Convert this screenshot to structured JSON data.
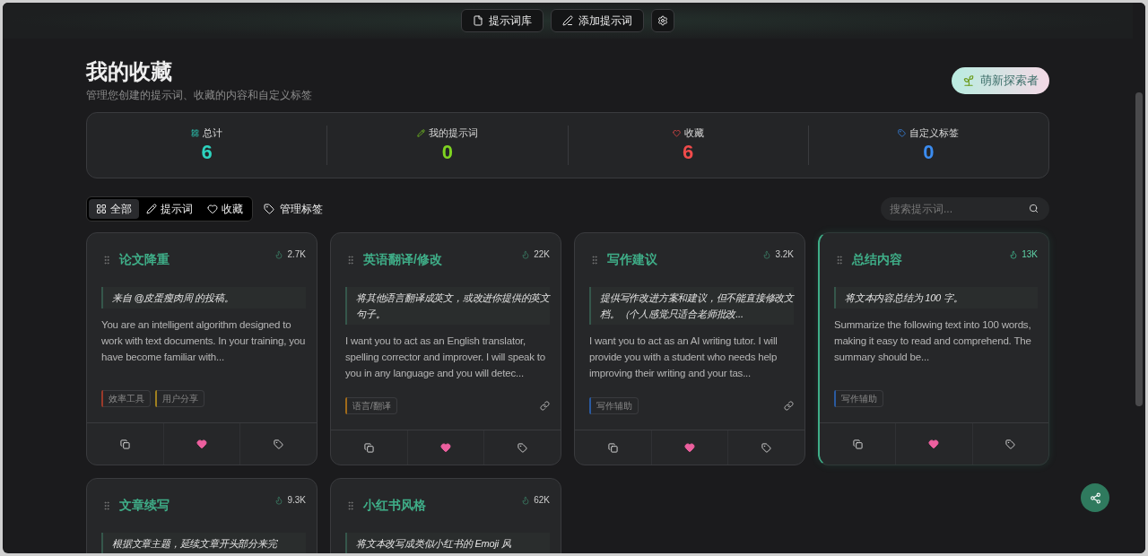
{
  "top_bar": {
    "buttons": [
      {
        "kind": "library",
        "label": "提示词库"
      },
      {
        "kind": "add",
        "label": "添加提示词"
      },
      {
        "kind": "settings"
      }
    ]
  },
  "header": {
    "title": "我的收藏",
    "subtitle": "管理您创建的提示词、收藏的内容和自定义标签",
    "badge": "萌新探索者"
  },
  "stats": [
    {
      "kind": "total",
      "label": "总计",
      "value": "6",
      "color": "#2dd4bf"
    },
    {
      "kind": "mine",
      "label": "我的提示词",
      "value": "0",
      "color": "#7ed321"
    },
    {
      "kind": "favorites",
      "label": "收藏",
      "value": "6",
      "color": "#f04b4b"
    },
    {
      "kind": "tags",
      "label": "自定义标签",
      "value": "0",
      "color": "#3b8cf0"
    }
  ],
  "filter_tabs": [
    {
      "kind": "all",
      "label": "全部",
      "selected": true
    },
    {
      "kind": "prompts",
      "label": "提示词",
      "selected": false
    },
    {
      "kind": "favorites",
      "label": "收藏",
      "selected": false
    }
  ],
  "manage_tags": "管理标签",
  "search": {
    "placeholder": "搜索提示词..."
  },
  "cards": [
    {
      "title": "论文降重",
      "views": "2.7K",
      "highlighted": false,
      "quote": "来自 @皮蛋瘦肉周 的投稿。",
      "body": "You are an intelligent algorithm designed to work with text documents. In your training, you have become familiar with...",
      "tags": [
        {
          "label": "效率工具",
          "color": "#9a3a2a"
        },
        {
          "label": "用户分享",
          "color": "#a08020"
        }
      ],
      "linked": false,
      "favorited": true
    },
    {
      "title": "英语翻译/修改",
      "views": "22K",
      "highlighted": false,
      "quote": "将其他语言翻译成英文，或改进你提供的英文句子。",
      "body": "I want you to act as an English translator, spelling corrector and improver. I will speak to you in any language and you will detec...",
      "tags": [
        {
          "label": "语言/翻译",
          "color": "#a06a1a"
        }
      ],
      "linked": true,
      "favorited": true
    },
    {
      "title": "写作建议",
      "views": "3.2K",
      "highlighted": false,
      "quote": "提供写作改进方案和建议，但不能直接修改文档。（个人感觉只适合老师批改...",
      "body": "I want you to act as an AI writing tutor. I will provide you with a student who needs help improving their writing and your tas...",
      "tags": [
        {
          "label": "写作辅助",
          "color": "#2a5aa0"
        }
      ],
      "linked": true,
      "favorited": true
    },
    {
      "title": "总结内容",
      "views": "13K",
      "highlighted": true,
      "quote": "将文本内容总结为 100 字。",
      "body": "Summarize the following text into 100 words, making it easy to read and comprehend. The summary should be...",
      "tags": [
        {
          "label": "写作辅助",
          "color": "#2a5aa0"
        }
      ],
      "linked": false,
      "favorited": true
    },
    {
      "title": "文章续写",
      "views": "9.3K",
      "highlighted": false,
      "quote": "根据文章主题，延续文章开头部分来完"
    },
    {
      "title": "小红书风格",
      "views": "62K",
      "highlighted": false,
      "quote": "将文本改写成类似小红书的 Emoji 风"
    }
  ]
}
